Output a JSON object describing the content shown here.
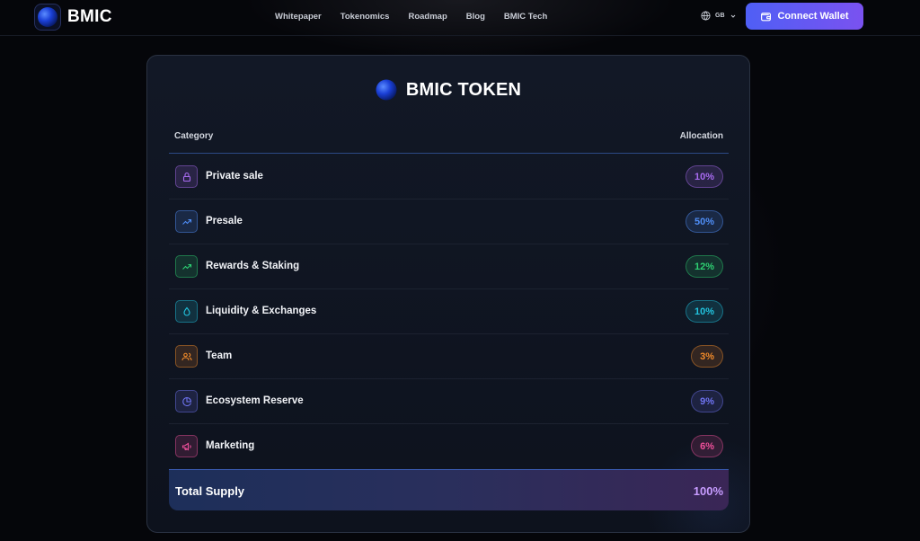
{
  "header": {
    "brand": "BMIC",
    "nav": [
      "Whitepaper",
      "Tokenomics",
      "Roadmap",
      "Blog",
      "BMIC Tech"
    ],
    "language_code": "GB",
    "connect_label": "Connect Wallet"
  },
  "card": {
    "title": "BMIC TOKEN",
    "col_category": "Category",
    "col_allocation": "Allocation",
    "rows": [
      {
        "label": "Private sale",
        "value": "10%",
        "icon": "lock-icon",
        "color": "#a86bf0"
      },
      {
        "label": "Presale",
        "value": "50%",
        "icon": "trending-up-icon",
        "color": "#4f8ef7"
      },
      {
        "label": "Rewards & Staking",
        "value": "12%",
        "icon": "trending-up-icon",
        "color": "#2ecf72"
      },
      {
        "label": "Liquidity & Exchanges",
        "value": "10%",
        "icon": "droplet-icon",
        "color": "#22c4df"
      },
      {
        "label": "Team",
        "value": "3%",
        "icon": "users-icon",
        "color": "#f08a2a"
      },
      {
        "label": "Ecosystem Reserve",
        "value": "9%",
        "icon": "pie-chart-icon",
        "color": "#6f74f2"
      },
      {
        "label": "Marketing",
        "value": "6%",
        "icon": "megaphone-icon",
        "color": "#ee4f9a"
      }
    ],
    "total_label": "Total Supply",
    "total_value": "100%"
  },
  "colors": {
    "accent_start": "#4f5ff5",
    "accent_end": "#7a52f0",
    "total_value": "#c79cff"
  }
}
